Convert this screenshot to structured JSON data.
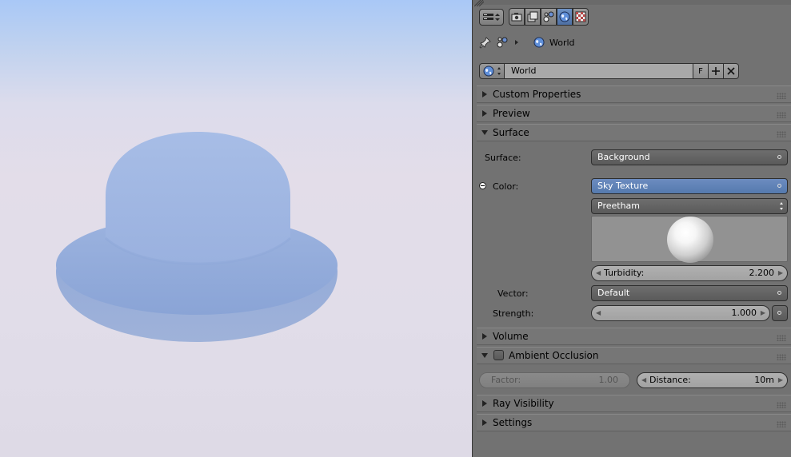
{
  "viewport": {
    "description_colors": {
      "sky_top": "#a9c8f6",
      "sky_bottom": "#dedae6",
      "object": "#8ca6d8"
    }
  },
  "header": {
    "context_icons": [
      "render-icon",
      "render-layers-icon",
      "scene-icon",
      "world-icon",
      "texture-icon"
    ],
    "active_context": "world-icon"
  },
  "breadcrumb": {
    "label": "World"
  },
  "datablock": {
    "name": "World",
    "fake_user_label": "F"
  },
  "sections": {
    "custom_properties": "Custom Properties",
    "preview": "Preview",
    "surface": "Surface",
    "volume": "Volume",
    "ambient_occlusion": "Ambient Occlusion",
    "ray_visibility": "Ray Visibility",
    "settings": "Settings"
  },
  "surface": {
    "surface_label": "Surface:",
    "surface_value": "Background",
    "color_label": "Color:",
    "color_value": "Sky Texture",
    "sky_type": "Preetham",
    "turbidity_label": "Turbidity:",
    "turbidity_value": "2.200",
    "vector_label": "Vector:",
    "vector_value": "Default",
    "strength_label": "Strength:",
    "strength_value": "1.000"
  },
  "ambient_occlusion": {
    "factor_label": "Factor:",
    "factor_value": "1.00",
    "distance_label": "Distance:",
    "distance_value": "10m"
  },
  "colors": {
    "panel_bg": "#727272",
    "active_blue": "#5b7fb3",
    "dark_field": "#606060"
  }
}
